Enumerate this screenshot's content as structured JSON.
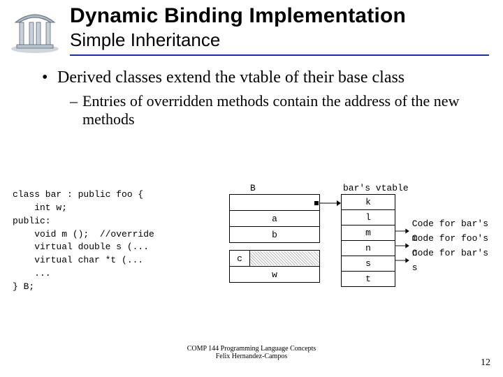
{
  "header": {
    "title": "Dynamic Binding Implementation",
    "subtitle": "Simple Inheritance"
  },
  "bullets": {
    "main": "Derived classes extend the vtable of their base class",
    "sub": "Entries of overridden methods contain the address of the new methods"
  },
  "code": {
    "l1": "class bar : public foo {",
    "l2": "    int w;",
    "l3": "public:",
    "l4": "    void m ();  //override",
    "l5": "    virtual double s (...",
    "l6": "    virtual char *t (...",
    "l7": "    ...",
    "l8": "} B;"
  },
  "object": {
    "label": "B",
    "rows": [
      "",
      "a",
      "b",
      "c",
      "w"
    ],
    "c_label": "c"
  },
  "vtable": {
    "label": "bar's vtable",
    "rows": [
      "k",
      "l",
      "m",
      "n",
      "s",
      "t"
    ]
  },
  "arrows": {
    "m": "Code for bar's m",
    "n": "Code for foo's n",
    "s": "Code for bar's s"
  },
  "footer": {
    "line1": "COMP 144 Programming Language Concepts",
    "line2": "Felix Hernandez-Campos"
  },
  "page_number": "12"
}
